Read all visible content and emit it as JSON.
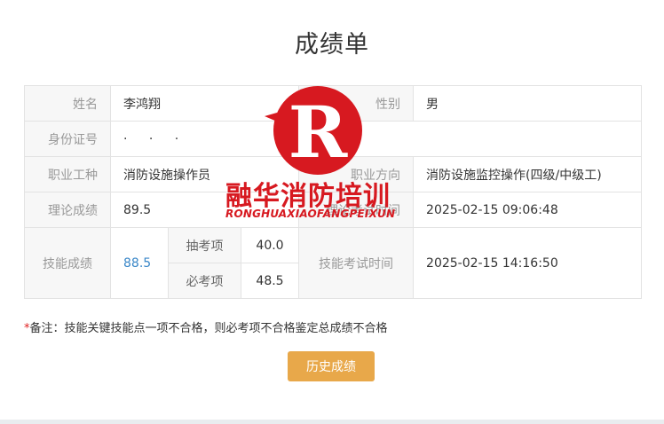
{
  "page": {
    "title": "成绩单"
  },
  "table": {
    "name_label": "姓名",
    "name_value": "李鸿翔",
    "gender_label": "性别",
    "gender_value": "男",
    "id_label": "身份证号",
    "id_value": "·  ·  ·",
    "occupation_label": "职业工种",
    "occupation_value": "消防设施操作员",
    "direction_label": "职业方向",
    "direction_value": "消防设施监控操作(四级/中级工)",
    "theory_label": "理论成绩",
    "theory_value": "89.5",
    "theory_time_label": "理论考试时间",
    "theory_time_value": "2025-02-15 09:06:48",
    "skill_label": "技能成绩",
    "skill_value": "88.5",
    "random_item_label": "抽考项",
    "random_item_value": "40.0",
    "required_item_label": "必考项",
    "required_item_value": "48.5",
    "skill_time_label": "技能考试时间",
    "skill_time_value": "2025-02-15 14:16:50"
  },
  "note": {
    "star": "*",
    "text": "备注：技能关键技能点一项不合格，则必考项不合格鉴定总成绩不合格"
  },
  "buttons": {
    "history": "历史成绩"
  },
  "watermark": {
    "brand": "融华消防培训",
    "brand_pinyin": "RONGHUAXIAOFANGPEIXUN"
  },
  "colors": {
    "accent": "#e8a84a",
    "link_blue": "#3a87c8",
    "watermark_red": "#d71920"
  }
}
